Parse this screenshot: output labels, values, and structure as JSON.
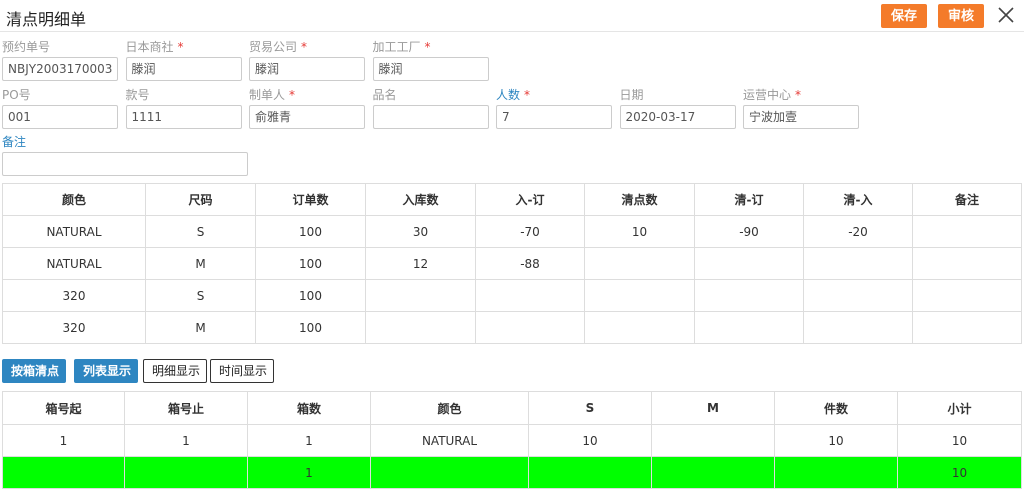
{
  "header": {
    "title": "清点明细单",
    "save_label": "保存",
    "review_label": "审核"
  },
  "form": {
    "row1": [
      {
        "label": "预约单号",
        "required": false,
        "blue": false,
        "value": "NBJY2003170003"
      },
      {
        "label": "日本商社",
        "required": true,
        "blue": false,
        "value": "滕润"
      },
      {
        "label": "贸易公司",
        "required": true,
        "blue": false,
        "value": "滕润"
      },
      {
        "label": "加工工厂",
        "required": true,
        "blue": false,
        "value": "滕润"
      }
    ],
    "row2": [
      {
        "label": "PO号",
        "required": false,
        "blue": false,
        "value": "001"
      },
      {
        "label": "款号",
        "required": false,
        "blue": false,
        "value": "1111"
      },
      {
        "label": "制单人",
        "required": true,
        "blue": false,
        "value": "俞雅青"
      },
      {
        "label": "品名",
        "required": false,
        "blue": false,
        "value": ""
      },
      {
        "label": "人数",
        "required": true,
        "blue": true,
        "value": "7"
      },
      {
        "label": "日期",
        "required": false,
        "blue": false,
        "value": "2020-03-17"
      },
      {
        "label": "运营中心",
        "required": true,
        "blue": false,
        "value": "宁波加壹"
      }
    ],
    "remark": {
      "label": "备注",
      "value": ""
    },
    "required_mark": "*"
  },
  "detail_table": {
    "headers": [
      "颜色",
      "尺码",
      "订单数",
      "入库数",
      "入-订",
      "清点数",
      "清-订",
      "清-入",
      "备注"
    ],
    "rows": [
      [
        "NATURAL",
        "S",
        "100",
        "30",
        "-70",
        "10",
        "-90",
        "-20",
        ""
      ],
      [
        "NATURAL",
        "M",
        "100",
        "12",
        "-88",
        "",
        "",
        "",
        ""
      ],
      [
        "320",
        "S",
        "100",
        "",
        "",
        "",
        "",
        "",
        ""
      ],
      [
        "320",
        "M",
        "100",
        "",
        "",
        "",
        "",
        "",
        ""
      ]
    ]
  },
  "toolbar": {
    "box_count_label": "按箱清点",
    "list_view_label": "列表显示",
    "detail_view_label": "明细显示",
    "time_view_label": "时间显示"
  },
  "box_table": {
    "headers": [
      "箱号起",
      "箱号止",
      "箱数",
      "颜色",
      "S",
      "M",
      "件数",
      "小计"
    ],
    "rows": [
      [
        "1",
        "1",
        "1",
        "NATURAL",
        "10",
        "",
        "10",
        "10"
      ]
    ],
    "total_row": [
      "",
      "",
      "1",
      "",
      "",
      "",
      "",
      "10"
    ]
  },
  "colors": {
    "accent_orange": "#f47b2a",
    "accent_blue": "#2e86c1",
    "negative": "#e53935",
    "total_row_bg": "#00ff00"
  }
}
